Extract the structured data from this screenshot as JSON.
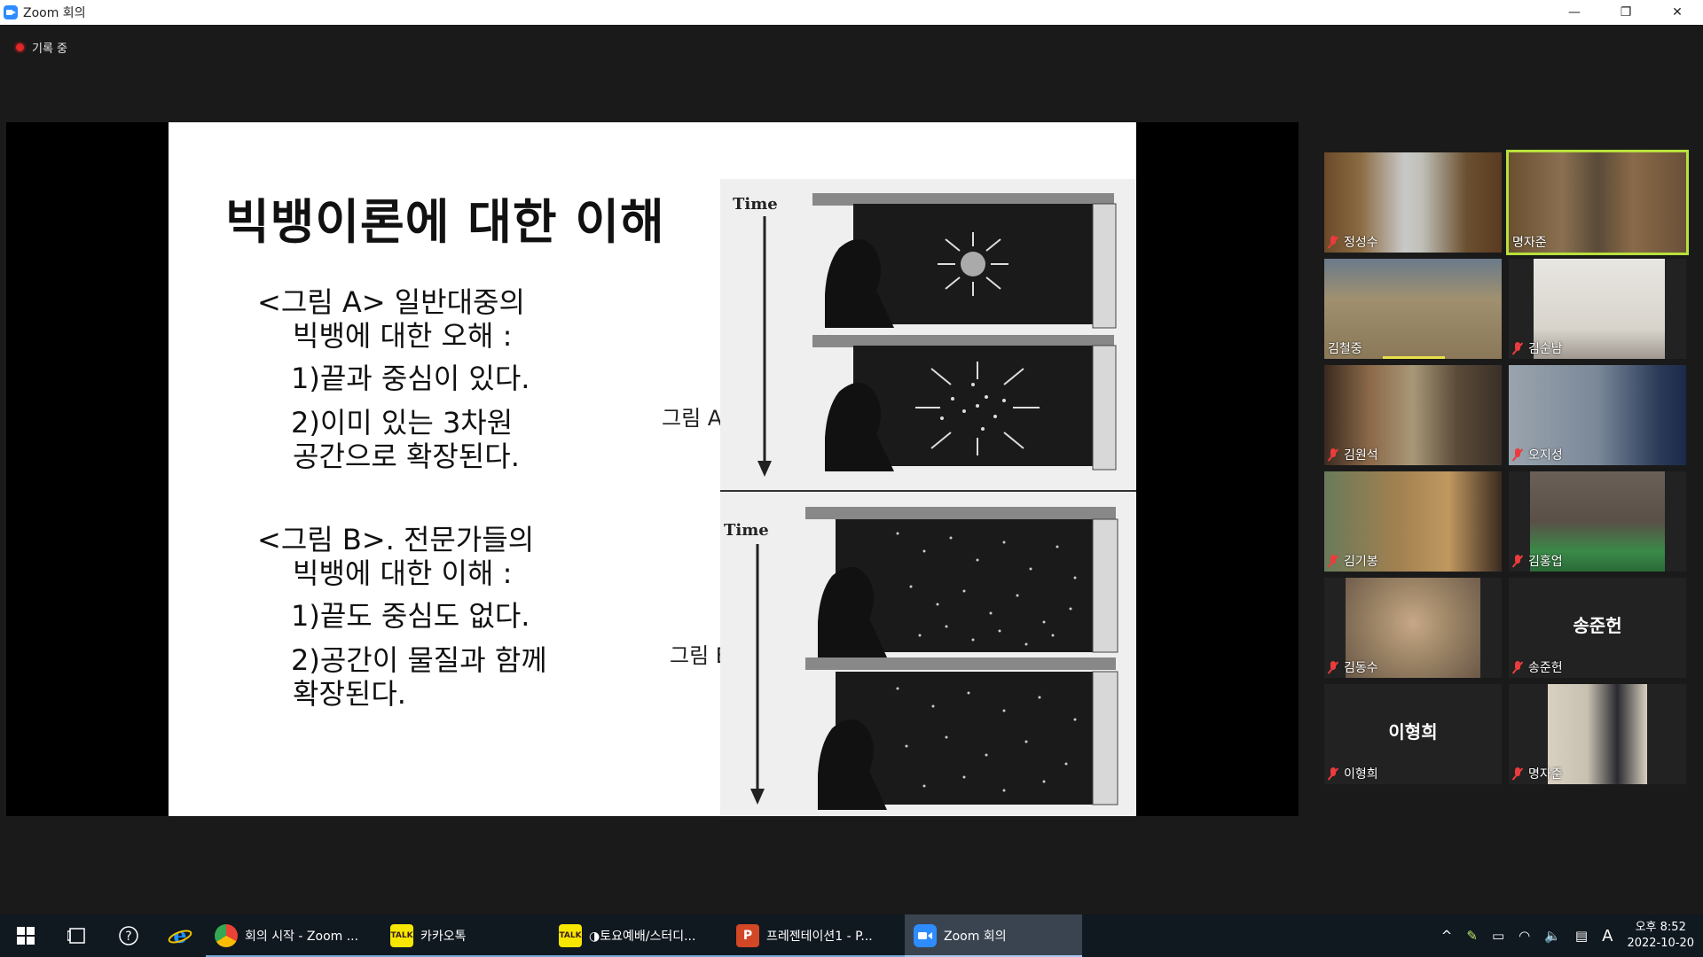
{
  "window": {
    "title": "Zoom 회의",
    "minimize": "—",
    "restore": "❐",
    "close": "✕"
  },
  "recording": {
    "label": "기록 중"
  },
  "slide": {
    "title": "빅뱅이론에 대한 이해",
    "a_heading_1": "<그림 A> 일반대중의",
    "a_heading_2": "빅뱅에 대한 오해 :",
    "a_point_1": "1)끝과 중심이 있다.",
    "a_point_2a": "2)이미 있는 3차원",
    "a_point_2b": "공간으로 확장된다.",
    "b_heading_1": "<그림 B>. 전문가들의",
    "b_heading_2": "빅뱅에 대한 이해 :",
    "b_point_1": "1)끝도 중심도 없다.",
    "b_point_2a": "2)공간이 물질과 함께",
    "b_point_2b": "확장된다.",
    "figure_label_a": "그림 A",
    "figure_label_b": "그림 B",
    "figure_time_a": "Time",
    "figure_time_b": "Time"
  },
  "participants": [
    {
      "name": "정성수",
      "video": true,
      "muted": true,
      "active": false,
      "bg": "#5b4a32"
    },
    {
      "name": "명자준",
      "video": true,
      "muted": false,
      "active": true,
      "bg": "#6a5640"
    },
    {
      "name": "김철중",
      "video": true,
      "muted": false,
      "active": false,
      "speaking": true,
      "bg": "#8a7a60"
    },
    {
      "name": "김순남",
      "video": true,
      "muted": true,
      "active": false,
      "bg": "#d8d4cc"
    },
    {
      "name": "김원석",
      "video": true,
      "muted": true,
      "active": false,
      "bg": "#4a3a30"
    },
    {
      "name": "오지성",
      "video": true,
      "muted": true,
      "active": false,
      "bg": "#7a8898"
    },
    {
      "name": "김기봉",
      "video": true,
      "muted": true,
      "active": false,
      "bg": "#7a6040"
    },
    {
      "name": "김홍업",
      "video": true,
      "muted": true,
      "active": false,
      "bg": "#5a5048"
    },
    {
      "name": "김동수",
      "video": true,
      "muted": true,
      "active": false,
      "bg": "#a08868"
    },
    {
      "name": "송준헌",
      "video": false,
      "muted": true,
      "active": false,
      "bg": "#222222"
    },
    {
      "name": "이형희",
      "video": false,
      "muted": true,
      "active": false,
      "bg": "#222222"
    },
    {
      "name": "명자준",
      "video": true,
      "muted": true,
      "active": false,
      "bg": "#c8c0b0"
    }
  ],
  "taskbar": {
    "apps": [
      {
        "label": "회의 시작 - Zoom ...",
        "icon": "chrome-icon",
        "color": "#e8453c",
        "underline": true
      },
      {
        "label": "카카오톡",
        "icon": "kakaotalk-icon",
        "color": "#f7e600",
        "iconText": "TALK",
        "underline": true
      },
      {
        "label": "◑토요예배/스터디...",
        "icon": "kakaotalk-chat-icon",
        "color": "#f7e600",
        "iconText": "TALK",
        "underline": true
      },
      {
        "label": "프레젠테이션1 - P...",
        "icon": "powerpoint-icon",
        "color": "#d24726",
        "iconText": "P",
        "underline": true
      },
      {
        "label": "Zoom 회의",
        "icon": "zoom-icon",
        "color": "#2d8cff",
        "underline": false,
        "active": true
      }
    ],
    "ime": "A",
    "time": "오후 8:52",
    "date": "2022-10-20"
  }
}
